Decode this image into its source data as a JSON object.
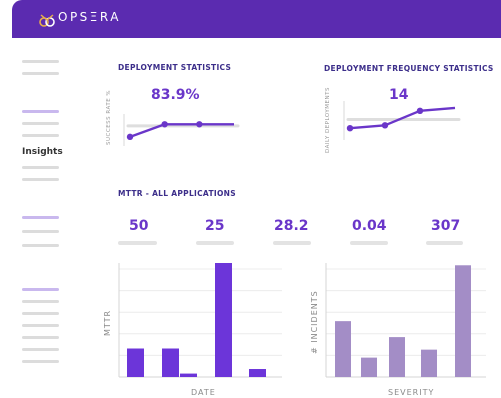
{
  "brand": {
    "name": "OPSΞRA"
  },
  "sidebar": {
    "label": "Insights"
  },
  "deployment_statistics": {
    "title": "DEPLOYMENT STATISTICS",
    "value": "83.9%",
    "axis_label": "SUCCESS RATE %"
  },
  "deployment_frequency": {
    "title": "DEPLOYMENT FREQUENCY STATISTICS",
    "value": "14",
    "axis_label": "DAILY DEPLOYMENTS"
  },
  "mttr": {
    "title": "MTTR - ALL APPLICATIONS",
    "values": [
      "50",
      "25",
      "28.2",
      "0.04",
      "307"
    ]
  },
  "colors": {
    "brand": "#5b2bb0",
    "accent": "#6a36c9",
    "bar_purple": "#6c35d9",
    "bar_lavender": "#a38dc6"
  },
  "chart_data": [
    {
      "type": "line",
      "x": [
        1,
        2,
        3,
        4
      ],
      "series": [
        {
          "values": [
            78,
            86,
            86,
            86
          ]
        }
      ],
      "ylabel": "SUCCESS RATE %"
    },
    {
      "type": "line",
      "x": [
        1,
        2,
        3,
        4
      ],
      "series": [
        {
          "values": [
            10,
            11,
            16,
            17
          ]
        }
      ],
      "ylabel": "DAILY DEPLOYMENTS"
    },
    {
      "type": "bar",
      "categories": [
        "1",
        "2",
        "3",
        "4",
        "5",
        "6"
      ],
      "values": [
        25,
        25,
        3,
        100,
        0,
        7
      ],
      "xlabel": "DATE",
      "ylabel": "MTTR"
    },
    {
      "type": "bar",
      "categories": [
        "1",
        "2",
        "3",
        "4",
        "5"
      ],
      "values": [
        49,
        17,
        35,
        24,
        98
      ],
      "xlabel": "SEVERITY",
      "ylabel": "# INCIDENTS"
    }
  ]
}
